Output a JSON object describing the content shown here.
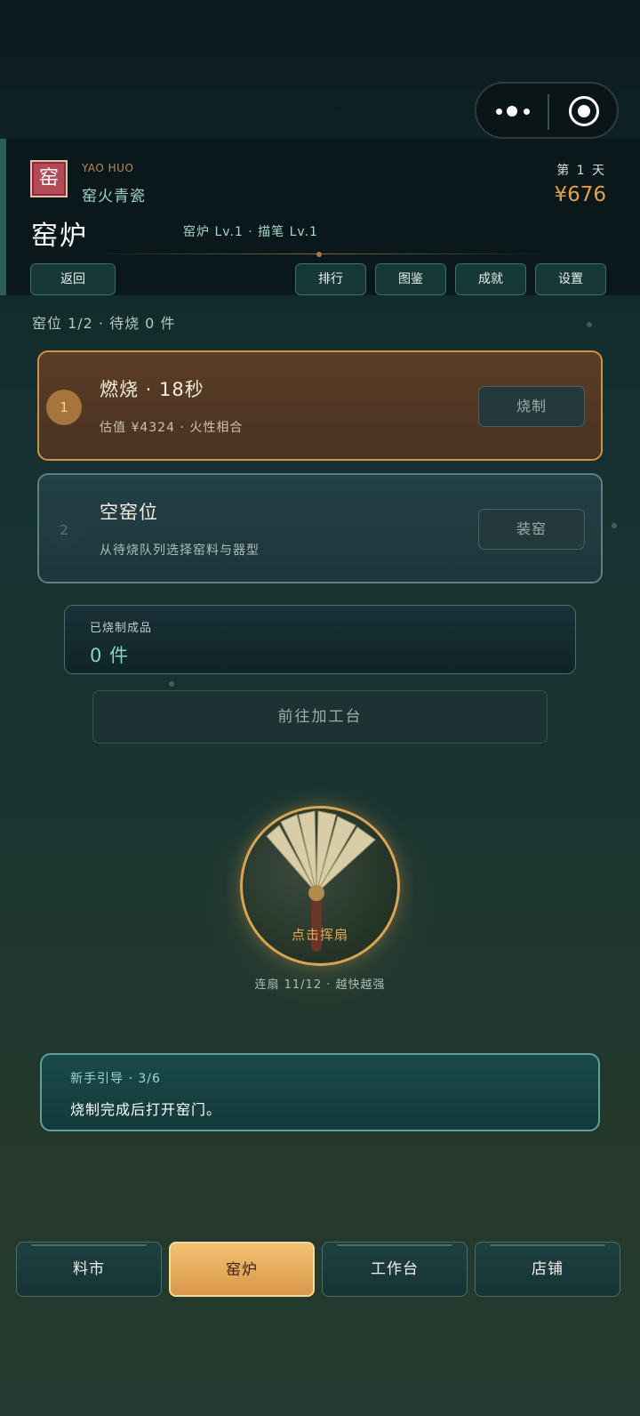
{
  "capsule": {
    "menu_icon": "more-dots-icon",
    "close_icon": "target-circle-icon"
  },
  "header": {
    "seal": "窑",
    "brand_en": "YAO HUO",
    "brand_cn": "窑火青瓷",
    "title": "窑炉",
    "levels": "窑炉 Lv.1 · 描笔 Lv.1",
    "day": "第 1 天",
    "money": "¥676",
    "back_label": "返回",
    "buttons": [
      "排行",
      "图鉴",
      "成就",
      "设置"
    ]
  },
  "status": "窑位 1/2 · 待烧 0 件",
  "slots": [
    {
      "number": "1",
      "title": "燃烧 · 18秒",
      "subtitle": "估值 ¥4324 · 火性相合",
      "action": "烧制"
    },
    {
      "number": "2",
      "title": "空窑位",
      "subtitle": "从待烧队列选择窑料与器型",
      "action": "装窑"
    }
  ],
  "finished": {
    "label": "已烧制成品",
    "value": "0 件"
  },
  "goto_label": "前往加工台",
  "fan": {
    "label": "点击挥扇",
    "combo": "连扇 11/12 · 越快越强",
    "icon": "folding-fan-icon"
  },
  "guide": {
    "step": "新手引导 · 3/6",
    "text": "烧制完成后打开窑门。"
  },
  "nav": {
    "items": [
      "料市",
      "窑炉",
      "工作台",
      "店铺"
    ],
    "active": "窑炉"
  },
  "colors": {
    "accent_gold": "#e0a04e",
    "teal": "#86d6c9",
    "seal_red": "#b24a58",
    "burning_card": "#5a3d26"
  }
}
